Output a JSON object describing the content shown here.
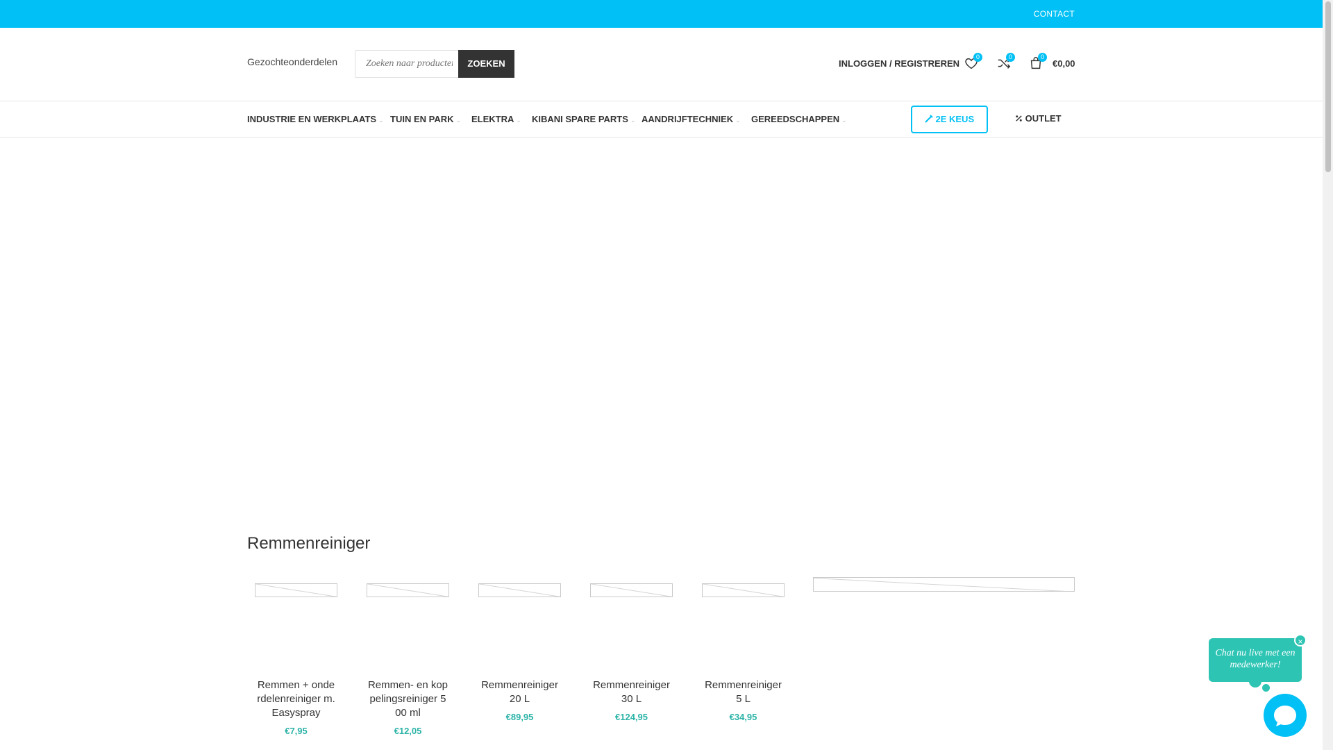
{
  "topbar": {
    "contact": "CONTACT"
  },
  "header": {
    "logo_alt": "Gezochteonderdelen",
    "search_placeholder": "Zoeken naar producten",
    "search_button": "ZOEKEN",
    "login": "INLOGGEN / REGISTREREN",
    "wishlist_count": "0",
    "compare_count": "0",
    "cart_count": "0",
    "cart_total": "€0,00"
  },
  "nav": {
    "items": [
      {
        "label": "INDUSTRIE EN WERKPLAATS"
      },
      {
        "label": "TUIN EN PARK"
      },
      {
        "label": "ELEKTRA"
      },
      {
        "label": "KIBANI SPARE PARTS"
      },
      {
        "label": "AANDRIJFTECHNIEK"
      },
      {
        "label": "GEREEDSCHAPPEN"
      }
    ],
    "second_choice": "2E KEUS",
    "outlet": "OUTLET"
  },
  "section": {
    "title": "Remmenreiniger",
    "products": [
      {
        "name": "Remmen + onderdelenreiniger m. Easyspray",
        "price": "€7,95"
      },
      {
        "name": "Remmen- en koppelingsreiniger 500 ml",
        "price": "€12,05"
      },
      {
        "name": "Remmenreiniger 20 L",
        "price": "€89,95"
      },
      {
        "name": "Remmenreiniger 30 L",
        "price": "€124,95"
      },
      {
        "name": "Remmenreiniger 5 L",
        "price": "€34,95"
      }
    ]
  },
  "chat": {
    "text": "Chat nu live met een medewerker!",
    "close": "×"
  },
  "colors": {
    "accent": "#00c0f5",
    "price": "#2bb3a7",
    "chat": "#2ec4b4"
  }
}
